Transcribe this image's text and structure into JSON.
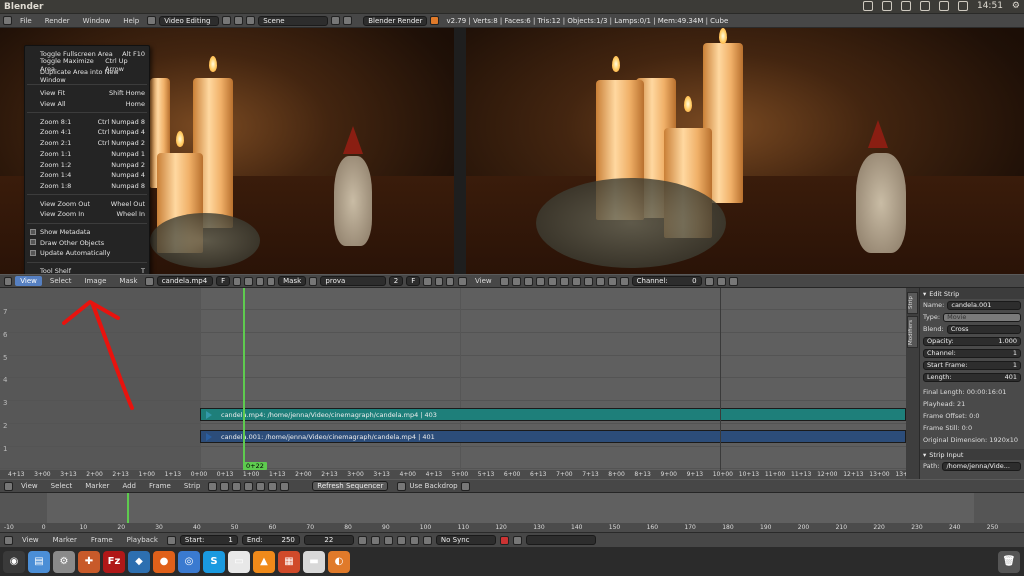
{
  "os": {
    "window_title": "Blender",
    "time": "14:51",
    "tray_icons": [
      "dropbox-icon",
      "wifi-icon",
      "mail-icon",
      "battery-icon",
      "keyboard-icon",
      "volume-icon",
      "gear-icon"
    ]
  },
  "infobar": {
    "menus": [
      "File",
      "Render",
      "Window",
      "Help"
    ],
    "screen_layout": "Video Editing",
    "scene": "Scene",
    "render_engine": "Blender Render",
    "stats": "v2.79 | Verts:8 | Faces:6 | Tris:12 | Objects:1/3 | Lamps:0/1 | Mem:49.34M | Cube"
  },
  "view_menu": {
    "items": [
      {
        "label": "Toggle Fullscreen Area",
        "shortcut": "Alt F10"
      },
      {
        "label": "Toggle Maximize Area",
        "shortcut": "Ctrl Up Arrow"
      },
      {
        "label": "Duplicate Area into New Window",
        "shortcut": ""
      },
      {
        "sep": true
      },
      {
        "label": "View Fit",
        "shortcut": "Shift Home"
      },
      {
        "label": "View All",
        "shortcut": "Home"
      },
      {
        "sep": true
      },
      {
        "label": "Zoom 8:1",
        "shortcut": "Ctrl Numpad 8"
      },
      {
        "label": "Zoom 4:1",
        "shortcut": "Ctrl Numpad 4"
      },
      {
        "label": "Zoom 2:1",
        "shortcut": "Ctrl Numpad 2"
      },
      {
        "label": "Zoom 1:1",
        "shortcut": "Numpad 1"
      },
      {
        "label": "Zoom 1:2",
        "shortcut": "Numpad 2"
      },
      {
        "label": "Zoom 1:4",
        "shortcut": "Numpad 4"
      },
      {
        "label": "Zoom 1:8",
        "shortcut": "Numpad 8"
      },
      {
        "sep": true
      },
      {
        "label": "View Zoom Out",
        "shortcut": "Wheel Out"
      },
      {
        "label": "View Zoom In",
        "shortcut": "Wheel In"
      },
      {
        "sep": true
      },
      {
        "label": "Show Metadata",
        "shortcut": "",
        "check": true
      },
      {
        "label": "Draw Other Objects",
        "shortcut": "",
        "check": true
      },
      {
        "label": "Update Automatically",
        "shortcut": "",
        "check": true
      },
      {
        "sep": true
      },
      {
        "label": "Tool Shelf",
        "shortcut": "T"
      },
      {
        "label": "Properties",
        "shortcut": "N",
        "selected": true
      }
    ]
  },
  "image_editor_header": {
    "menus": [
      "View",
      "Select",
      "Image",
      "Mask"
    ],
    "image_name": "candela.mp4",
    "image_users": "F",
    "mask_mode": "Mask",
    "mask_name": "prova",
    "mask_users": "2",
    "mask_flag": "F"
  },
  "seq_preview_header": {
    "menus": [
      "View"
    ],
    "channel_label": "Channel:",
    "channel_value": "0"
  },
  "sequencer": {
    "strips": [
      {
        "label": "candela.mp4: /home/jenna/Video/cinemagraph/candela.mp4 | 403",
        "color": "#1e7f7a"
      },
      {
        "label": "candela.001: /home/jenna/Video/cinemagraph/candela.mp4 | 401",
        "color": "#2c4d7a"
      }
    ],
    "time_ticks": [
      "4+13",
      "3+00",
      "3+13",
      "2+00",
      "2+13",
      "1+00",
      "1+13",
      "0+00",
      "0+13",
      "1+00",
      "1+13",
      "2+00",
      "2+13",
      "3+00",
      "3+13",
      "4+00",
      "4+13",
      "5+00",
      "5+13",
      "6+00",
      "6+13",
      "7+00",
      "7+13",
      "8+00",
      "8+13",
      "9+00",
      "9+13",
      "10+00",
      "10+13",
      "11+00",
      "11+13",
      "12+00",
      "12+13",
      "13+00",
      "13+13"
    ],
    "playhead_label": "0+22",
    "channel_numbers": [
      "7",
      "6",
      "5",
      "4",
      "3",
      "2",
      "1"
    ]
  },
  "properties": {
    "tabs": [
      "Strip",
      "Modifiers"
    ],
    "section": "Edit Strip",
    "name_label": "Name:",
    "name": "candela.001",
    "type_label": "Type:",
    "type": "Movie",
    "blend_label": "Blend:",
    "blend": "Cross",
    "opacity_label": "Opacity:",
    "opacity": "1.000",
    "channel_label": "Channel:",
    "channel": "1",
    "start_label": "Start Frame:",
    "start": "1",
    "length_label": "Length:",
    "length": "401",
    "final_length": "Final Length: 00:00:16:01",
    "playhead": "Playhead: 21",
    "frame_offset": "Frame Offset: 0:0",
    "frame_still": "Frame Still: 0:0",
    "original_dimension": "Original Dimension: 1920x10",
    "section2": "Strip Input",
    "path_label": "Path:",
    "path": "/home/jenna/Vide..."
  },
  "seq_header": {
    "menus": [
      "View",
      "Select",
      "Marker",
      "Add",
      "Frame",
      "Strip"
    ],
    "refresh": "Refresh Sequencer",
    "use_backdrop": "Use Backdrop"
  },
  "timeline": {
    "ticks": [
      "-10",
      "0",
      "10",
      "20",
      "30",
      "40",
      "50",
      "60",
      "70",
      "80",
      "90",
      "100",
      "110",
      "120",
      "130",
      "140",
      "150",
      "160",
      "170",
      "180",
      "190",
      "200",
      "210",
      "220",
      "230",
      "240",
      "250",
      "260"
    ],
    "menus": [
      "View",
      "Marker",
      "Frame",
      "Playback"
    ],
    "start_label": "Start:",
    "start": "1",
    "end_label": "End:",
    "end": "250",
    "current": "22",
    "sync": "No Sync"
  },
  "launcher": {
    "apps": [
      {
        "name": "ubuntu-home-icon",
        "bg": "#3a3a3a",
        "glyph": "◉"
      },
      {
        "name": "files-icon",
        "bg": "#4b8ed6",
        "glyph": "▤"
      },
      {
        "name": "settings-icon",
        "bg": "#8a8a8a",
        "glyph": "⚙"
      },
      {
        "name": "software-icon",
        "bg": "#c85a2a",
        "glyph": "✚"
      },
      {
        "name": "filezilla-icon",
        "bg": "#b01818",
        "glyph": "Fz"
      },
      {
        "name": "vscode-icon",
        "bg": "#2d6fb0",
        "glyph": "◆"
      },
      {
        "name": "firefox-icon",
        "bg": "#e0601a",
        "glyph": "●"
      },
      {
        "name": "chromium-icon",
        "bg": "#3a7ad0",
        "glyph": "◎"
      },
      {
        "name": "skype-icon",
        "bg": "#1a9ae0",
        "glyph": "S"
      },
      {
        "name": "drive-icon",
        "bg": "#e8e8e8",
        "glyph": "▭"
      },
      {
        "name": "vlc-icon",
        "bg": "#f08a1a",
        "glyph": "▲"
      },
      {
        "name": "presentation-icon",
        "bg": "#d04a2a",
        "glyph": "▦"
      },
      {
        "name": "scanner-icon",
        "bg": "#d8d8d8",
        "glyph": "▬"
      },
      {
        "name": "blender-icon",
        "bg": "#e07a2a",
        "glyph": "◐"
      }
    ],
    "trash": "trash-icon"
  },
  "colors": {
    "accent": "#5680c2",
    "playhead": "#5ecb4f",
    "annotation": "#e8130e"
  }
}
